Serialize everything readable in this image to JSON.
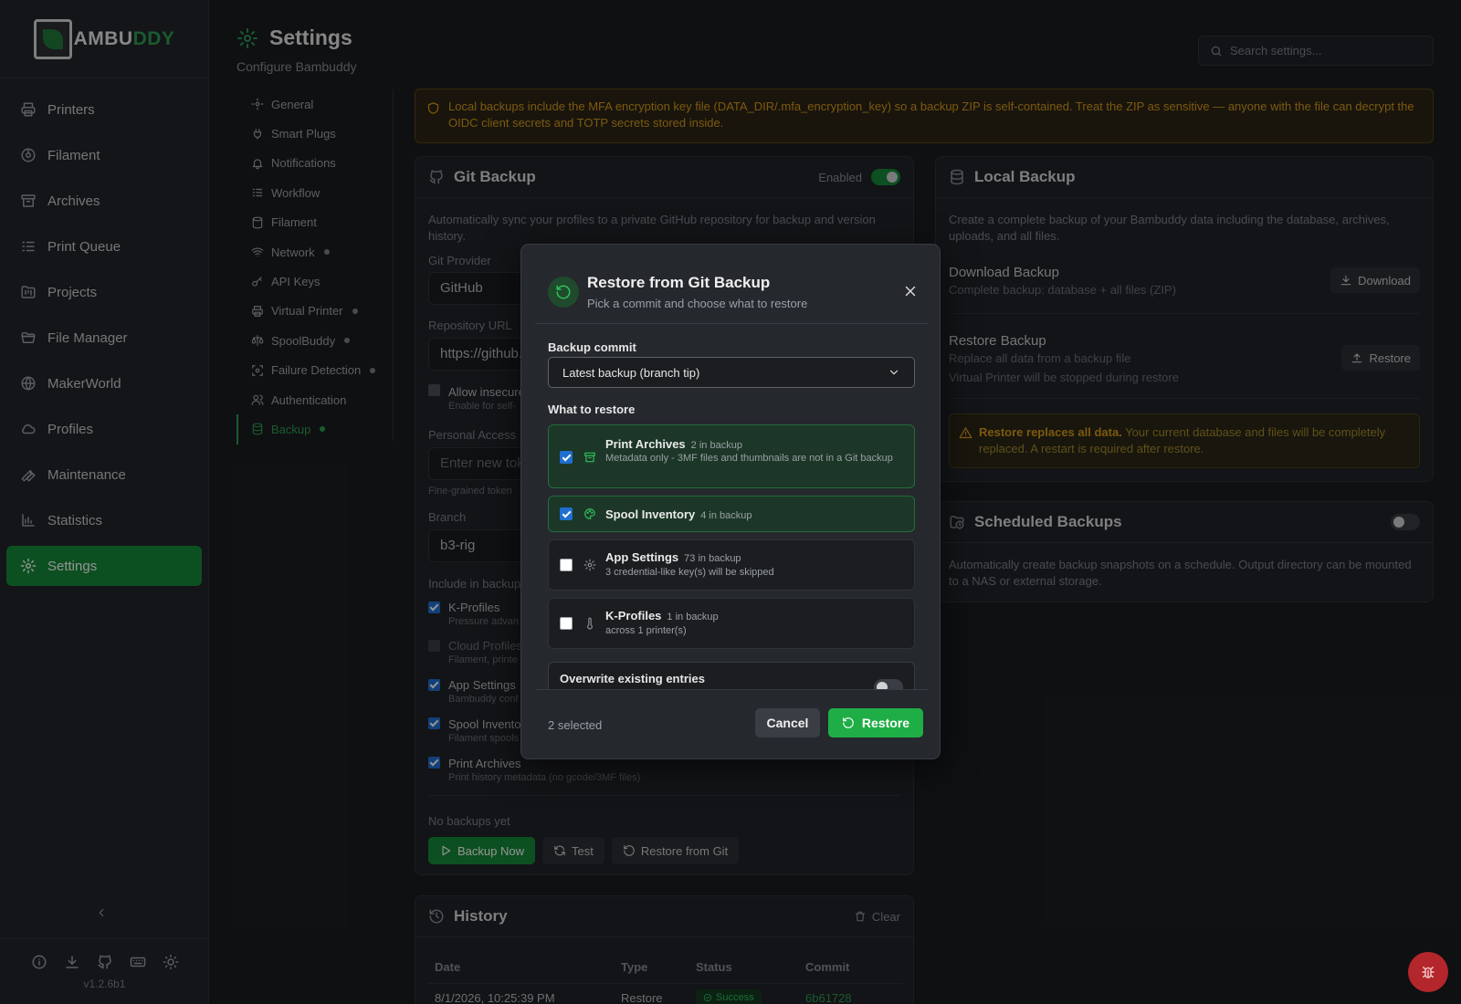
{
  "app": {
    "logo_prefix": "AMBU",
    "logo_suffix": "DDY",
    "version": "v1.2.6b1"
  },
  "sidebar": {
    "items": [
      {
        "label": "Printers",
        "icon": "printer-icon"
      },
      {
        "label": "Filament",
        "icon": "spool-icon"
      },
      {
        "label": "Archives",
        "icon": "archive-icon"
      },
      {
        "label": "Print Queue",
        "icon": "list-icon"
      },
      {
        "label": "Projects",
        "icon": "folder-kanban-icon"
      },
      {
        "label": "File Manager",
        "icon": "folder-open-icon"
      },
      {
        "label": "MakerWorld",
        "icon": "globe-icon"
      },
      {
        "label": "Profiles",
        "icon": "cloud-icon"
      },
      {
        "label": "Maintenance",
        "icon": "wrench-icon"
      },
      {
        "label": "Statistics",
        "icon": "bar-chart-icon"
      },
      {
        "label": "Settings",
        "icon": "gear-icon",
        "active": true
      }
    ]
  },
  "header": {
    "title": "Settings",
    "subtitle": "Configure Bambuddy",
    "search_placeholder": "Search settings..."
  },
  "subnav": {
    "items": [
      {
        "label": "General"
      },
      {
        "label": "Smart Plugs"
      },
      {
        "label": "Notifications"
      },
      {
        "label": "Workflow"
      },
      {
        "label": "Filament"
      },
      {
        "label": "Network",
        "dot": true
      },
      {
        "label": "API Keys"
      },
      {
        "label": "Virtual Printer",
        "dot": true
      },
      {
        "label": "SpoolBuddy",
        "dot": true
      },
      {
        "label": "Failure Detection",
        "dot": true
      },
      {
        "label": "Authentication"
      },
      {
        "label": "Backup",
        "dot": true,
        "active": true
      }
    ]
  },
  "banner": {
    "text": "Local backups include the MFA encryption key file (DATA_DIR/.mfa_encryption_key) so a backup ZIP is self-contained. Treat the ZIP as sensitive — anyone with the file can decrypt the OIDC client secrets and TOTP secrets stored inside."
  },
  "git_backup": {
    "title": "Git Backup",
    "enabled_label": "Enabled",
    "description": "Automatically sync your profiles to a private GitHub repository for backup and version history.",
    "provider_label": "Git Provider",
    "provider_value": "GitHub",
    "repo_label": "Repository URL",
    "repo_value": "https://github.com/",
    "allow_insecure_label": "Allow insecure",
    "allow_insecure_sub": "Enable for self-",
    "token_label": "Personal Access",
    "token_placeholder": "Enter new tok",
    "token_hint": "Fine-grained token",
    "branch_label": "Branch",
    "branch_value": "b3-rig",
    "include_label": "Include in backup",
    "include": [
      {
        "label": "K-Profiles",
        "sub": "Pressure advan"
      },
      {
        "label": "Cloud Profiles",
        "sub": "Filament, printe"
      },
      {
        "label": "App Settings",
        "sub": "Bambuddy conf"
      },
      {
        "label": "Spool Inventory",
        "sub": "Filament spools"
      },
      {
        "label": "Print Archives",
        "sub": "Print history metadata (no gcode/3MF files)"
      }
    ],
    "no_backups": "No backups yet",
    "backup_now": "Backup Now",
    "test": "Test",
    "restore_from_git": "Restore from Git"
  },
  "local_backup": {
    "title": "Local Backup",
    "description": "Create a complete backup of your Bambuddy data including the database, archives, uploads, and all files.",
    "download_title": "Download Backup",
    "download_sub": "Complete backup: database + all files (ZIP)",
    "download_btn": "Download",
    "restore_title": "Restore Backup",
    "restore_sub": "Replace all data from a backup file",
    "restore_note": "Virtual Printer will be stopped during restore",
    "restore_btn": "Restore",
    "warn_bold": "Restore replaces all data.",
    "warn_text": " Your current database and files will be completely replaced. A restart is required after restore."
  },
  "scheduled": {
    "title": "Scheduled Backups",
    "description": "Automatically create backup snapshots on a schedule. Output directory can be mounted to a NAS or external storage."
  },
  "history": {
    "title": "History",
    "clear": "Clear",
    "columns": [
      "Date",
      "Type",
      "Status",
      "Commit"
    ],
    "rows": [
      {
        "date": "8/1/2026, 10:25:39 PM",
        "type": "Restore",
        "status": "Success",
        "commit": "6b61728"
      }
    ]
  },
  "modal": {
    "title": "Restore from Git Backup",
    "subtitle": "Pick a commit and choose what to restore",
    "commit_label": "Backup commit",
    "commit_value": "Latest backup (branch tip)",
    "what_label": "What to restore",
    "options": [
      {
        "title": "Print Archives",
        "count": "2 in backup",
        "desc": "Metadata only - 3MF files and thumbnails are not in a Git backup",
        "checked": true,
        "icon": "archive-icon"
      },
      {
        "title": "Spool Inventory",
        "count": "4 in backup",
        "desc": "",
        "checked": true,
        "icon": "palette-icon"
      },
      {
        "title": "App Settings",
        "count": "73 in backup",
        "desc": "3 credential-like key(s) will be skipped",
        "checked": false,
        "icon": "gear-icon"
      },
      {
        "title": "K-Profiles",
        "count": "1 in backup",
        "desc": "across 1 printer(s)",
        "checked": false,
        "icon": "thermometer-icon"
      }
    ],
    "overwrite_label": "Overwrite existing entries",
    "selected_count": "2 selected",
    "cancel": "Cancel",
    "restore": "Restore"
  },
  "colors": {
    "accent": "#168a3a",
    "accent_bright": "#1fae46",
    "warning": "#d79a1a",
    "danger": "#b3262b"
  }
}
